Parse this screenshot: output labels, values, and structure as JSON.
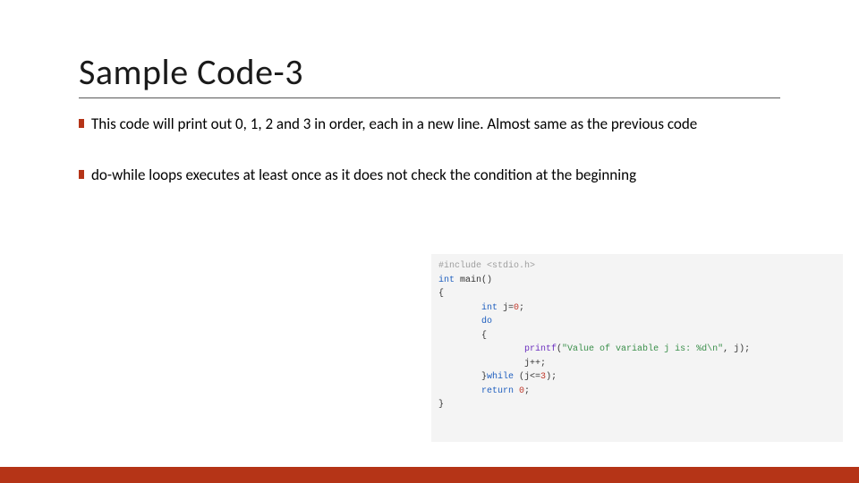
{
  "title": "Sample Code-3",
  "bullets": [
    "This code will print out 0, 1, 2 and 3 in order, each in a new line. Almost same as the previous code",
    "do-while loops executes at least once as it does not check the condition at the beginning"
  ],
  "code": {
    "l1a": "#include ",
    "l1b": "<stdio.h>",
    "l2a": "int",
    "l2b": " main()",
    "l3": "{",
    "l4a": "        int",
    "l4b": " j=",
    "l4c": "0",
    "l4d": ";",
    "l5": "        do",
    "l6": "        {",
    "l7a": "                printf",
    "l7b": "(",
    "l7c": "\"Value of variable j is: %d\\n\"",
    "l7d": ", j);",
    "l8": "                j++;",
    "l9a": "        }",
    "l9b": "while",
    "l9c": " (j<=",
    "l9d": "3",
    "l9e": ");",
    "l10a": "        return ",
    "l10b": "0",
    "l10c": ";",
    "l11": "}"
  }
}
